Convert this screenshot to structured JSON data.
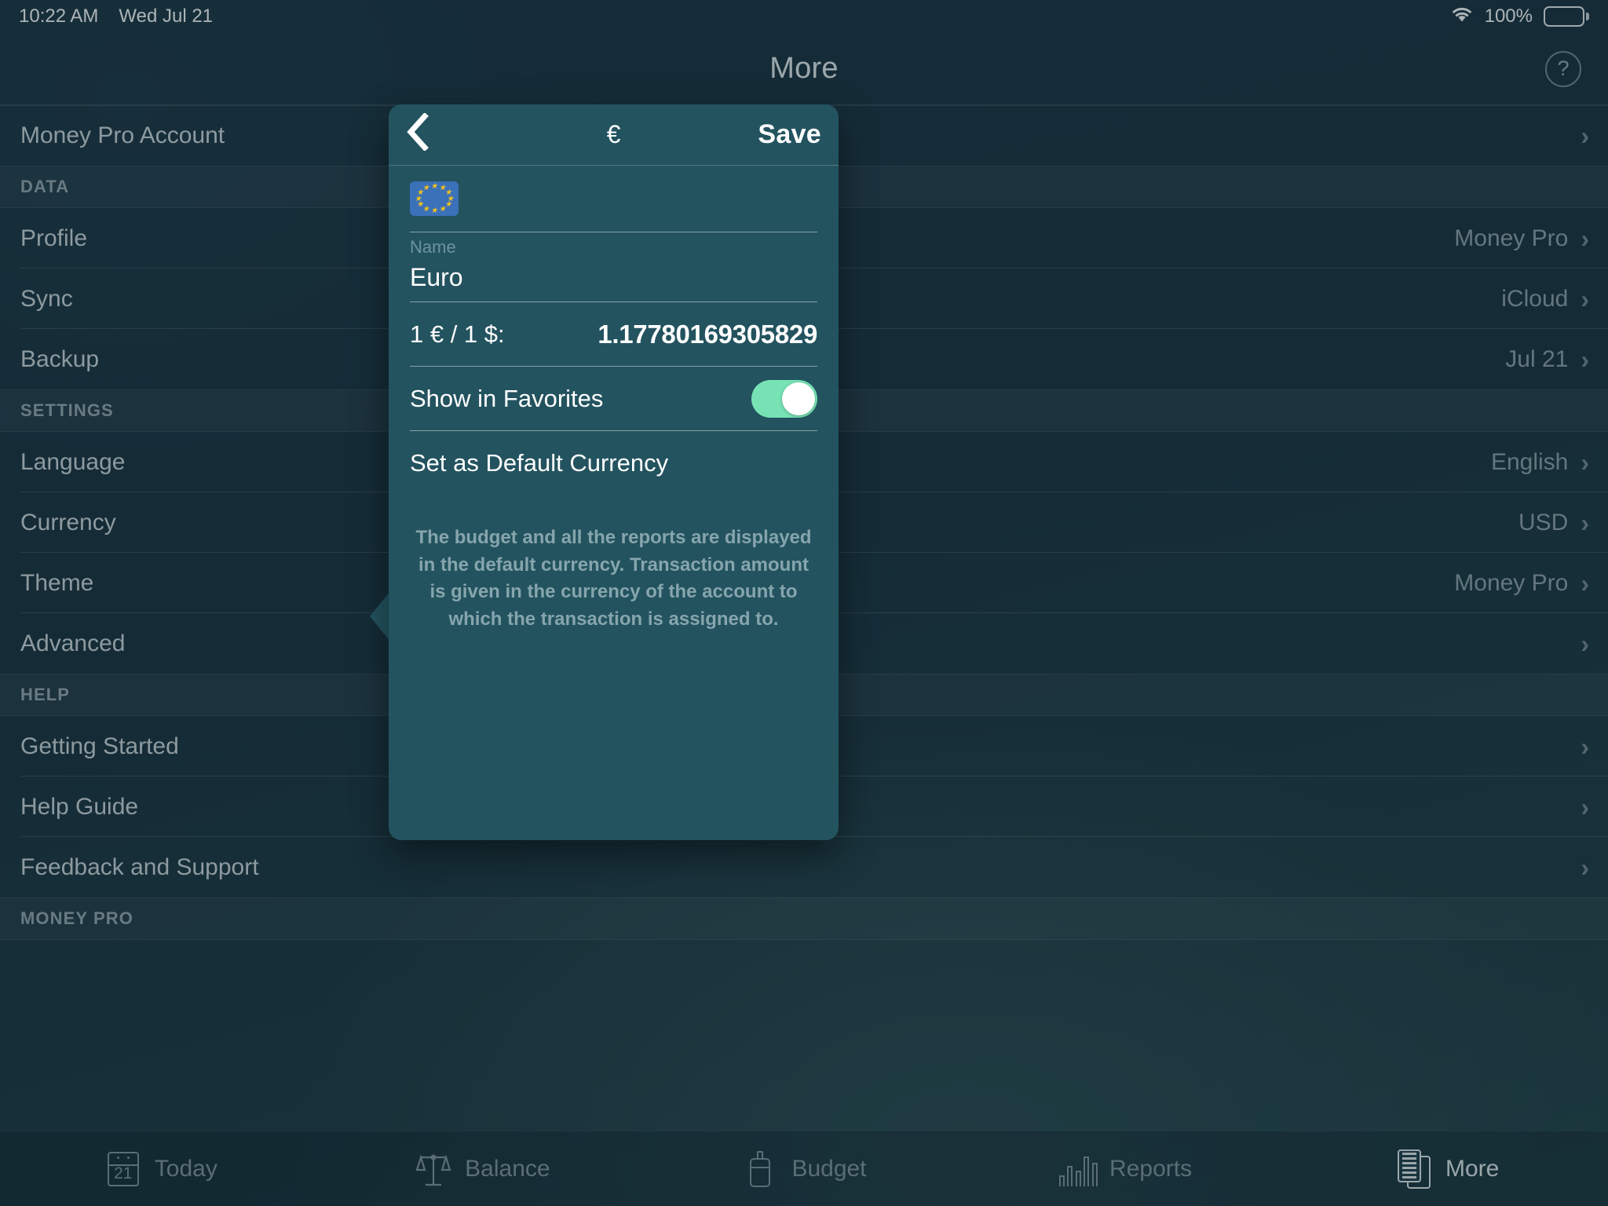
{
  "status_bar": {
    "time": "10:22 AM",
    "date": "Wed Jul 21",
    "battery_percent": "100%",
    "wifi_icon": "wifi-icon",
    "battery_icon": "battery-icon"
  },
  "nav": {
    "title": "More",
    "help_icon": "question-mark-icon",
    "help_label": "?"
  },
  "settings_list": {
    "account_row": {
      "label": "Money Pro Account",
      "value": "",
      "chevron": "›"
    },
    "sections": [
      {
        "header": "DATA",
        "rows": [
          {
            "label": "Profile",
            "value": "Money Pro",
            "chevron": "›"
          },
          {
            "label": "Sync",
            "value": "iCloud",
            "chevron": "›"
          },
          {
            "label": "Backup",
            "value": "Jul 21",
            "chevron": "›"
          }
        ]
      },
      {
        "header": "SETTINGS",
        "rows": [
          {
            "label": "Language",
            "value": "English",
            "chevron": "›"
          },
          {
            "label": "Currency",
            "value": "USD",
            "chevron": "›"
          },
          {
            "label": "Theme",
            "value": "Money Pro",
            "chevron": "›"
          },
          {
            "label": "Advanced",
            "value": "",
            "chevron": "›"
          }
        ]
      },
      {
        "header": "HELP",
        "rows": [
          {
            "label": "Getting Started",
            "value": "",
            "chevron": "›"
          },
          {
            "label": "Help Guide",
            "value": "",
            "chevron": "›"
          },
          {
            "label": "Feedback and Support",
            "value": "",
            "chevron": "›"
          }
        ]
      },
      {
        "header": "MONEY PRO",
        "rows": []
      }
    ]
  },
  "popover": {
    "back_icon": "chevron-left-icon",
    "back_label": "‹",
    "title": "€",
    "save_label": "Save",
    "flag_icon": "european-union-flag-icon",
    "name_label": "Name",
    "name_value": "Euro",
    "rate_label": "1 € / 1 $:",
    "rate_value": "1.17780169305829",
    "favorites_label": "Show in Favorites",
    "favorites_on": true,
    "default_currency_label": "Set as Default Currency",
    "note": "The budget and all the reports are displayed in the default currency. Transaction amount is given in the currency of the account to which the transaction is assigned to.",
    "accent_color": "#77e3b5",
    "panel_color": "#23535f"
  },
  "tabbar": {
    "tabs": [
      {
        "label": "Today",
        "icon": "calendar-icon",
        "day": "21",
        "active": false
      },
      {
        "label": "Balance",
        "icon": "scales-icon",
        "active": false
      },
      {
        "label": "Budget",
        "icon": "bottle-icon",
        "active": false
      },
      {
        "label": "Reports",
        "icon": "bar-chart-icon",
        "active": false
      },
      {
        "label": "More",
        "icon": "documents-icon",
        "active": true
      }
    ]
  }
}
